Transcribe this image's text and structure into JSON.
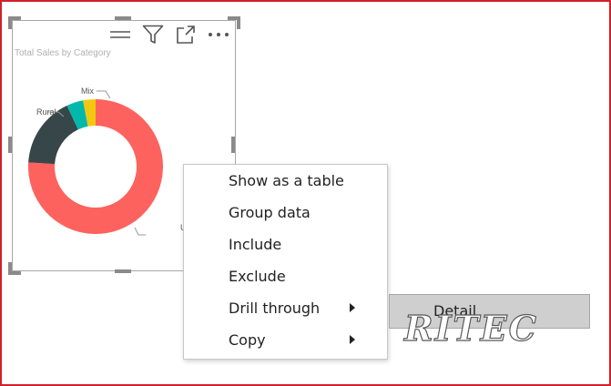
{
  "visual": {
    "title": "Total Sales by Category",
    "toolbar": {
      "icons": [
        "drag-handle-icon",
        "filter-icon",
        "focus-mode-icon",
        "more-options-icon"
      ]
    }
  },
  "chart_data": {
    "type": "pie",
    "donut": true,
    "title": "Total Sales by Category",
    "categories": [
      "Urban",
      "Rural",
      "Mix",
      "Youth"
    ],
    "values": [
      76,
      17,
      4,
      3
    ],
    "labels_visible": [
      "Rural",
      "Mix",
      "U"
    ],
    "colors": [
      "#fd625e",
      "#374649",
      "#01b8aa",
      "#f2c80f"
    ]
  },
  "context_menu": {
    "items": [
      {
        "label": "Show as a table",
        "submenu": false
      },
      {
        "label": "Group data",
        "submenu": false
      },
      {
        "label": "Include",
        "submenu": false
      },
      {
        "label": "Exclude",
        "submenu": false
      },
      {
        "label": "Drill through",
        "submenu": true
      },
      {
        "label": "Copy",
        "submenu": true
      }
    ]
  },
  "submenu": {
    "label": "Detail"
  },
  "watermark": {
    "text": "RITEC"
  },
  "colors": {
    "frame_border": "#d0202a",
    "selection_border": "#a8a8a8",
    "submenu_bg": "#cfcfcf"
  }
}
